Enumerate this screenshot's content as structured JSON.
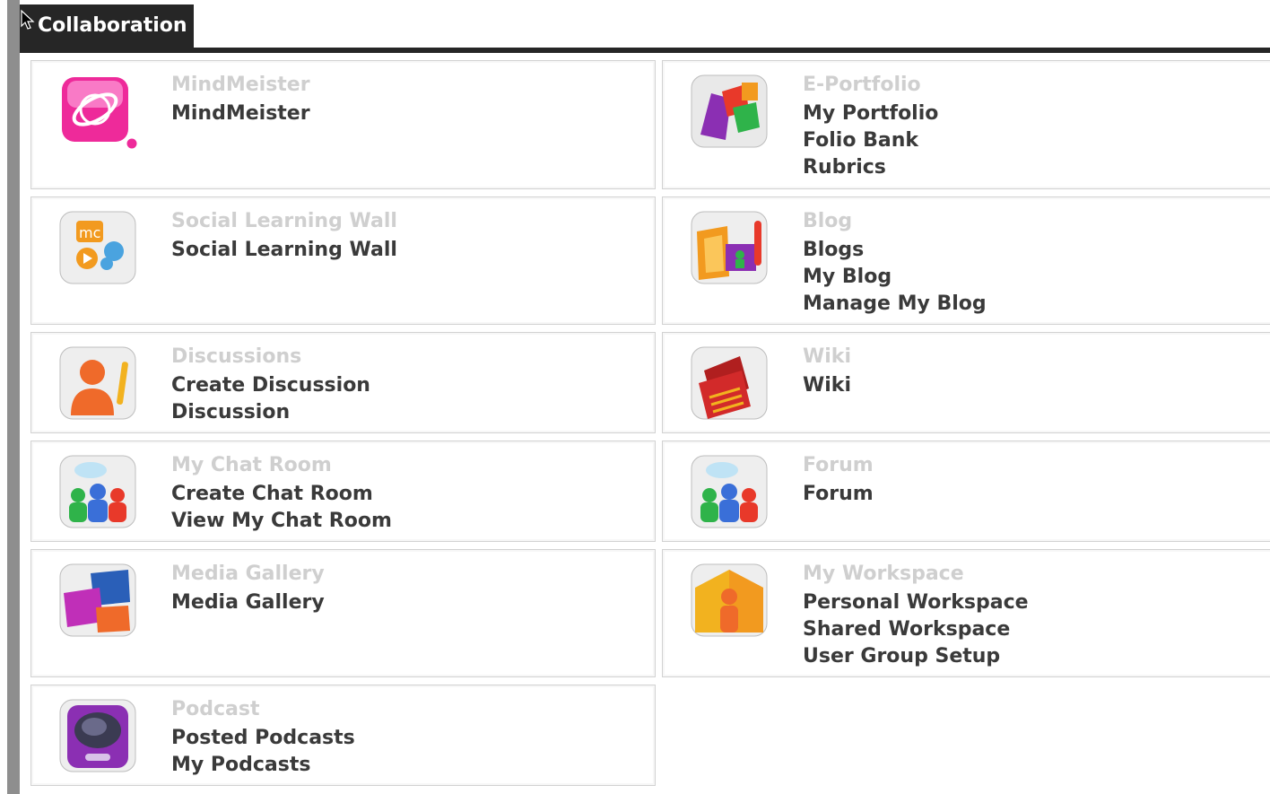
{
  "tab": {
    "label": "Collaboration"
  },
  "cards": [
    {
      "title": "MindMeister",
      "links": [
        "MindMeister"
      ],
      "icon": "mindmeister-icon"
    },
    {
      "title": "E-Portfolio",
      "links": [
        "My Portfolio",
        "Folio Bank",
        "Rubrics"
      ],
      "icon": "eportfolio-icon"
    },
    {
      "title": "Social Learning Wall",
      "links": [
        "Social Learning Wall"
      ],
      "icon": "social-wall-icon"
    },
    {
      "title": "Blog",
      "links": [
        "Blogs",
        "My Blog",
        "Manage My Blog"
      ],
      "icon": "blog-icon"
    },
    {
      "title": "Discussions",
      "links": [
        "Create Discussion",
        "Discussion"
      ],
      "icon": "discussion-icon"
    },
    {
      "title": "Wiki",
      "links": [
        "Wiki"
      ],
      "icon": "wiki-icon"
    },
    {
      "title": "My Chat Room",
      "links": [
        "Create Chat Room",
        "View My Chat Room"
      ],
      "icon": "chat-room-icon"
    },
    {
      "title": "Forum",
      "links": [
        "Forum"
      ],
      "icon": "forum-icon"
    },
    {
      "title": "Media Gallery",
      "links": [
        "Media Gallery"
      ],
      "icon": "media-gallery-icon"
    },
    {
      "title": "My Workspace",
      "links": [
        "Personal Workspace",
        "Shared Workspace",
        "User Group Setup"
      ],
      "icon": "workspace-icon"
    },
    {
      "title": "Podcast",
      "links": [
        "Posted Podcasts",
        "My Podcasts"
      ],
      "icon": "podcast-icon"
    }
  ]
}
